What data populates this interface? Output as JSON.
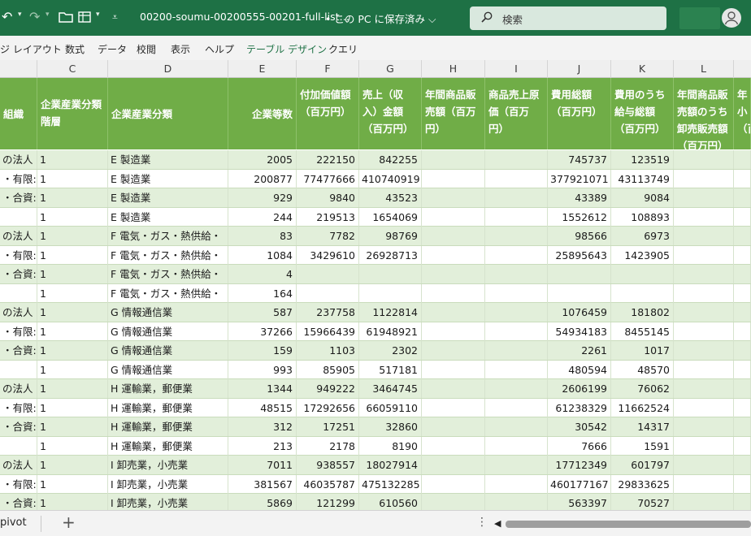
{
  "titlebar": {
    "doc_title": "00200-soumu-00200555-00201-full-list…",
    "save_state": "• この PC に保存済み",
    "search_placeholder": "検索"
  },
  "ribbon": {
    "tabs": [
      {
        "label": "ジ レイアウト",
        "accent": false
      },
      {
        "label": "数式",
        "accent": false
      },
      {
        "label": "データ",
        "accent": false
      },
      {
        "label": "校閲",
        "accent": false
      },
      {
        "label": "表示",
        "accent": false
      },
      {
        "label": "ヘルプ",
        "accent": false
      },
      {
        "label": "テーブル デザイン",
        "accent": true
      },
      {
        "label": "クエリ",
        "accent": false
      }
    ]
  },
  "columns": [
    "C",
    "D",
    "E",
    "F",
    "G",
    "H",
    "I",
    "J",
    "K",
    "L"
  ],
  "headers": [
    "組織",
    "企業産業分類階層",
    "企業産業分類",
    "企業等数",
    "付加価値額（百万円）",
    "売上（収入）金額（百万円）",
    "年間商品販売額（百万円）",
    "商品売上原価（百万円）",
    "費用総額（百万円）",
    "費用のうち給与総額（百万円）",
    "年間商品販売額のうち卸売販売額（百万円）",
    "年小（百"
  ],
  "rows": [
    [
      "の法人",
      "1",
      "E 製造業",
      "2005",
      "222150",
      "842255",
      "",
      "",
      "745737",
      "123519",
      "",
      ""
    ],
    [
      "・有限:",
      "1",
      "E 製造業",
      "200877",
      "77477666",
      "410740919",
      "",
      "",
      "377921071",
      "43113749",
      "",
      ""
    ],
    [
      "・合資:",
      "1",
      "E 製造業",
      "929",
      "9840",
      "43523",
      "",
      "",
      "43389",
      "9084",
      "",
      ""
    ],
    [
      "",
      "1",
      "E 製造業",
      "244",
      "219513",
      "1654069",
      "",
      "",
      "1552612",
      "108893",
      "",
      ""
    ],
    [
      "の法人",
      "1",
      "F 電気・ガス・熱供給・",
      "83",
      "7782",
      "98769",
      "",
      "",
      "98566",
      "6973",
      "",
      ""
    ],
    [
      "・有限:",
      "1",
      "F 電気・ガス・熱供給・",
      "1084",
      "3429610",
      "26928713",
      "",
      "",
      "25895643",
      "1423905",
      "",
      ""
    ],
    [
      "・合資:",
      "1",
      "F 電気・ガス・熱供給・",
      "4",
      "",
      "",
      "",
      "",
      "",
      "",
      "",
      ""
    ],
    [
      "",
      "1",
      "F 電気・ガス・熱供給・",
      "164",
      "",
      "",
      "",
      "",
      "",
      "",
      "",
      ""
    ],
    [
      "の法人",
      "1",
      "G 情報通信業",
      "587",
      "237758",
      "1122814",
      "",
      "",
      "1076459",
      "181802",
      "",
      ""
    ],
    [
      "・有限:",
      "1",
      "G 情報通信業",
      "37266",
      "15966439",
      "61948921",
      "",
      "",
      "54934183",
      "8455145",
      "",
      ""
    ],
    [
      "・合資:",
      "1",
      "G 情報通信業",
      "159",
      "1103",
      "2302",
      "",
      "",
      "2261",
      "1017",
      "",
      ""
    ],
    [
      "",
      "1",
      "G 情報通信業",
      "993",
      "85905",
      "517181",
      "",
      "",
      "480594",
      "48570",
      "",
      ""
    ],
    [
      "の法人",
      "1",
      "H 運輸業，郵便業",
      "1344",
      "949222",
      "3464745",
      "",
      "",
      "2606199",
      "76062",
      "",
      ""
    ],
    [
      "・有限:",
      "1",
      "H 運輸業，郵便業",
      "48515",
      "17292656",
      "66059110",
      "",
      "",
      "61238329",
      "11662524",
      "",
      ""
    ],
    [
      "・合資:",
      "1",
      "H 運輸業，郵便業",
      "312",
      "17251",
      "32860",
      "",
      "",
      "30542",
      "14317",
      "",
      ""
    ],
    [
      "",
      "1",
      "H 運輸業，郵便業",
      "213",
      "2178",
      "8190",
      "",
      "",
      "7666",
      "1591",
      "",
      ""
    ],
    [
      "の法人",
      "1",
      "I 卸売業，小売業",
      "7011",
      "938557",
      "18027914",
      "",
      "",
      "17712349",
      "601797",
      "",
      ""
    ],
    [
      "・有限:",
      "1",
      "I 卸売業，小売業",
      "381567",
      "46035787",
      "475132285",
      "",
      "",
      "460177167",
      "29833625",
      "",
      ""
    ],
    [
      "・合資:",
      "1",
      "I 卸売業，小売業",
      "5869",
      "121299",
      "610560",
      "",
      "",
      "563397",
      "70527",
      "",
      ""
    ]
  ],
  "sheetbar": {
    "sheet_name": "pivot",
    "add_label": "+"
  },
  "colors": {
    "title_green": "#1e7145",
    "header_green": "#70ad47",
    "band_green": "#e2efda"
  }
}
